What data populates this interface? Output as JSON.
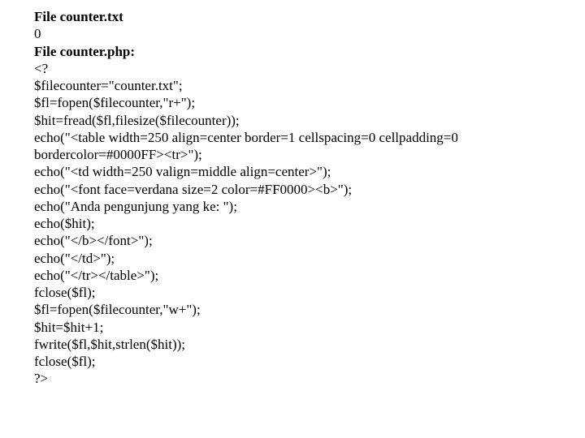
{
  "lines": [
    {
      "text": "File counter.txt",
      "bold": true
    },
    {
      "text": "0",
      "bold": false
    },
    {
      "text": "File counter.php:",
      "bold": true
    },
    {
      "text": "<?",
      "bold": false
    },
    {
      "text": "$filecounter=\"counter.txt\";",
      "bold": false
    },
    {
      "text": "$fl=fopen($filecounter,\"r+\");",
      "bold": false
    },
    {
      "text": "$hit=fread($fl,filesize($filecounter));",
      "bold": false
    },
    {
      "text": "echo(\"<table width=250 align=center border=1 cellspacing=0 cellpadding=0 bordercolor=#0000FF><tr>\");",
      "bold": false
    },
    {
      "text": "echo(\"<td width=250 valign=middle align=center>\");",
      "bold": false
    },
    {
      "text": "echo(\"<font face=verdana size=2 color=#FF0000><b>\");",
      "bold": false
    },
    {
      "text": "echo(\"Anda pengunjung yang ke: \");",
      "bold": false
    },
    {
      "text": "echo($hit);",
      "bold": false
    },
    {
      "text": "echo(\"</b></font>\");",
      "bold": false
    },
    {
      "text": "echo(\"</td>\");",
      "bold": false
    },
    {
      "text": "echo(\"</tr></table>\");",
      "bold": false
    },
    {
      "text": "fclose($fl);",
      "bold": false
    },
    {
      "text": "$fl=fopen($filecounter,\"w+\");",
      "bold": false
    },
    {
      "text": "$hit=$hit+1;",
      "bold": false
    },
    {
      "text": "fwrite($fl,$hit,strlen($hit));",
      "bold": false
    },
    {
      "text": "fclose($fl);",
      "bold": false
    },
    {
      "text": "?>",
      "bold": false
    }
  ]
}
